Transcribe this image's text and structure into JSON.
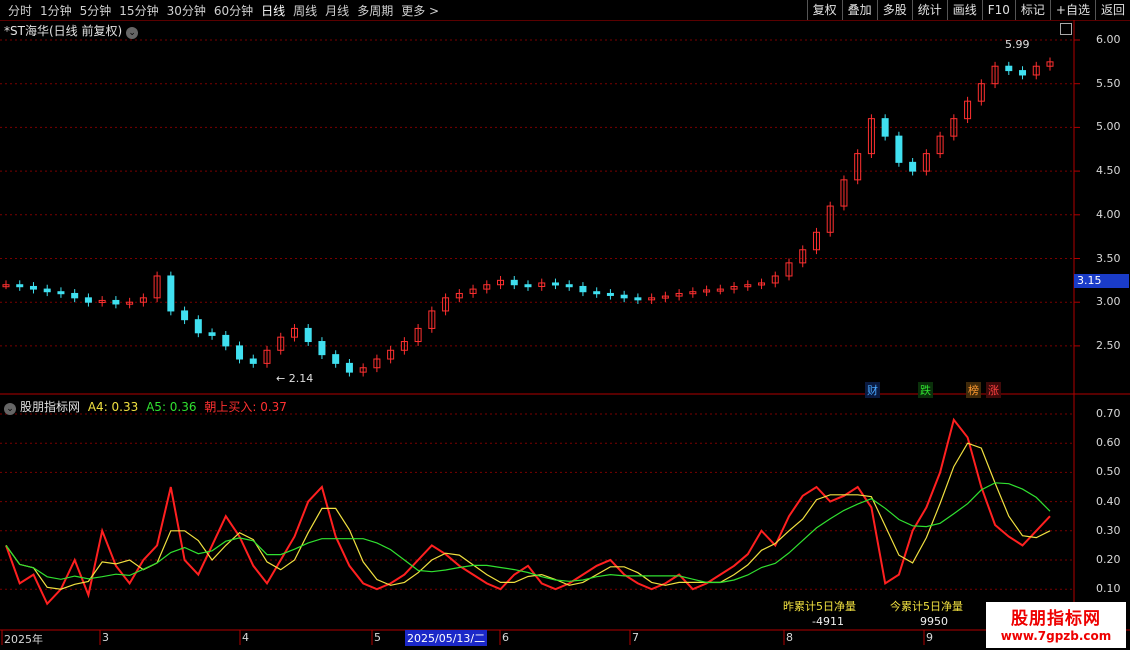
{
  "toolbar": {
    "periods": [
      "分时",
      "1分钟",
      "5分钟",
      "15分钟",
      "30分钟",
      "60分钟",
      "日线",
      "周线",
      "月线",
      "多周期",
      "更多 >"
    ],
    "active": "日线",
    "actions": [
      "复权",
      "叠加",
      "多股",
      "统计",
      "画线",
      "F10",
      "标记",
      "+自选",
      "返回"
    ]
  },
  "stock": {
    "title": "*ST海华(日线 前复权)",
    "high_label": "5.99",
    "low_label": "← 2.14",
    "current_price": "3.15"
  },
  "price_axis": [
    "6.00",
    "5.50",
    "5.00",
    "4.50",
    "4.00",
    "3.50",
    "3.00",
    "2.50"
  ],
  "events": [
    {
      "text": "财",
      "color": "#4aa8ff",
      "bg": "#0a1a40"
    },
    {
      "text": "跌",
      "color": "#30e030",
      "bg": "#0a300a"
    },
    {
      "text": "榜",
      "color": "#ff9a30",
      "bg": "#402a0a"
    },
    {
      "text": "涨",
      "color": "#ff4040",
      "bg": "#400a0a"
    }
  ],
  "indicator": {
    "name": "股朋指标网",
    "a4": "A4: 0.33",
    "a5": "A5: 0.36",
    "buy": "朝上买入: 0.37",
    "axis": [
      "0.70",
      "0.60",
      "0.50",
      "0.40",
      "0.30",
      "0.20",
      "0.10"
    ]
  },
  "stats": {
    "prev_label": "昨累计5日净量",
    "prev_value": "-4911",
    "today_label": "今累计5日净量",
    "today_value": "9950"
  },
  "dates": [
    "2025年",
    "3",
    "4",
    "5",
    "6",
    "7",
    "8",
    "9"
  ],
  "date_highlight": "2025/05/13/二",
  "watermark": {
    "title": "股朋指标网",
    "url": "www.7gpzb.com"
  },
  "colors": {
    "up": "#ff3030",
    "down": "#40e0f0",
    "grid": "#7a0000"
  }
}
